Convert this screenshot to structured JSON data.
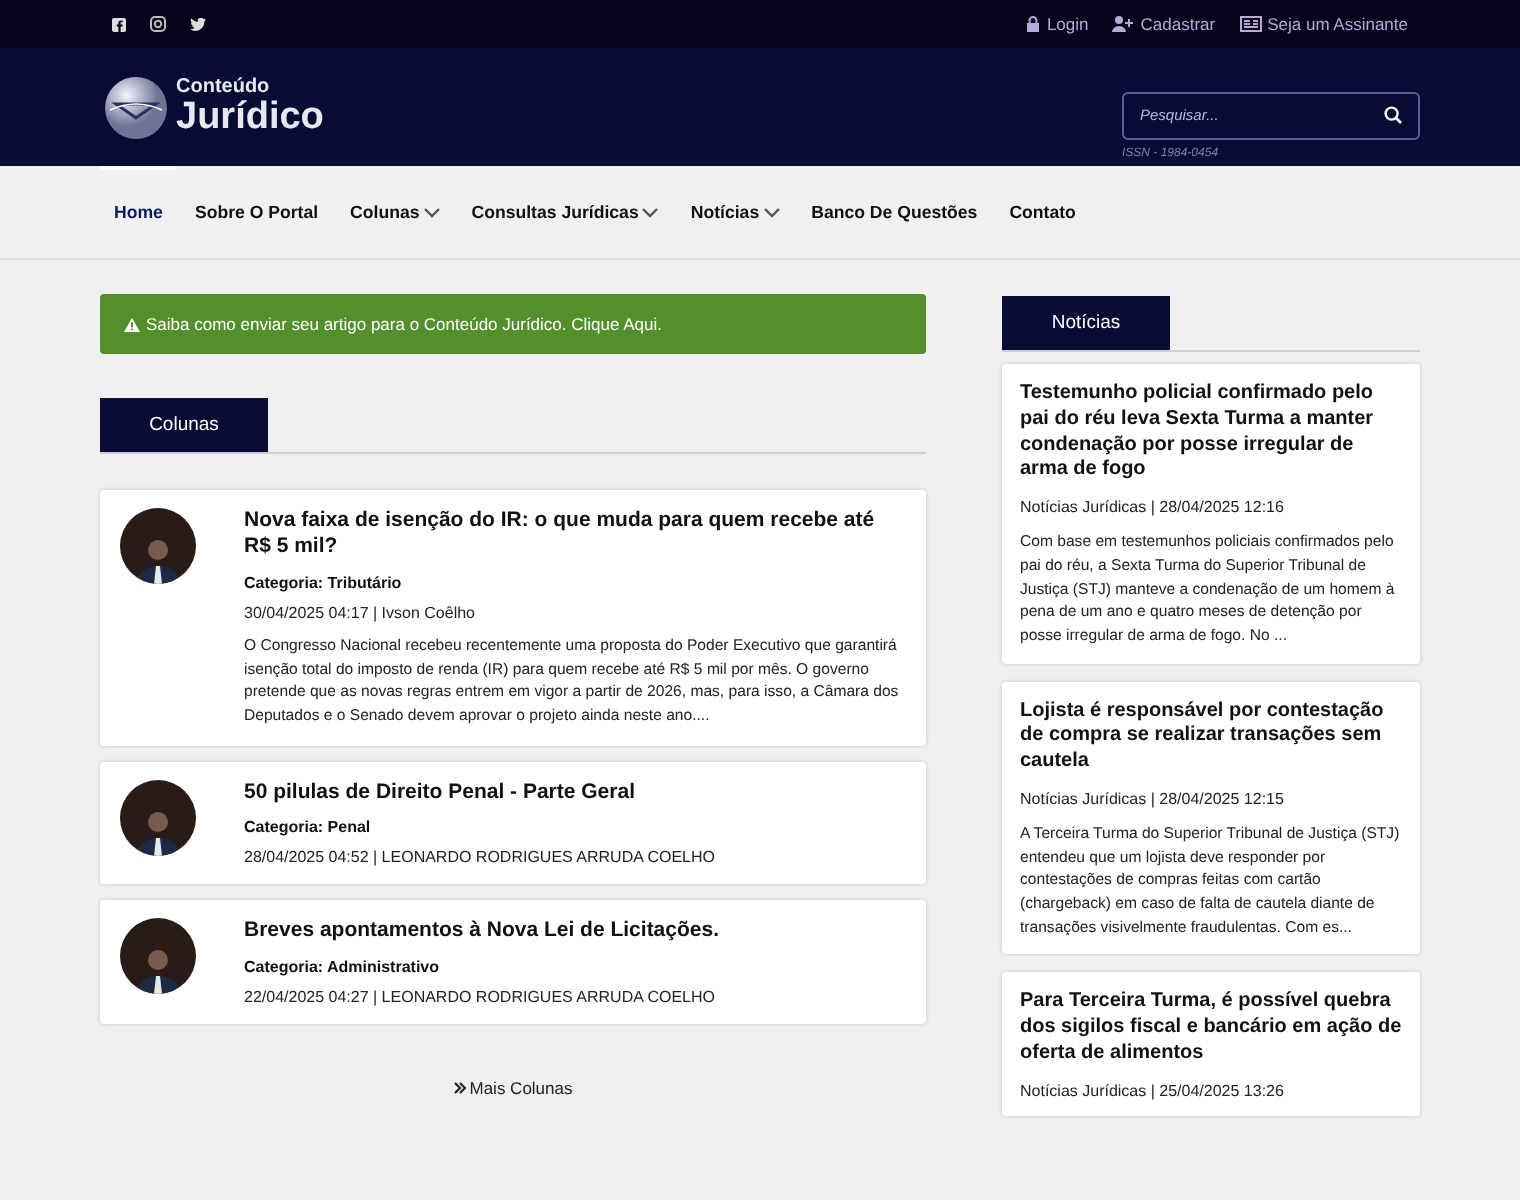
{
  "top_bar": {
    "links": [
      {
        "label": "Login"
      },
      {
        "label": "Cadastrar"
      },
      {
        "label": "Seja um Assinante"
      }
    ]
  },
  "header": {
    "logo": {
      "small": "Conteúdo",
      "big": "Jurídico"
    },
    "search": {
      "placeholder": "Pesquisar..."
    },
    "issn": "ISSN - 1984-0454"
  },
  "nav": [
    {
      "label": "Home",
      "selected": true,
      "dropdown": false
    },
    {
      "label": "Sobre O Portal",
      "selected": false,
      "dropdown": false
    },
    {
      "label": "Colunas",
      "selected": false,
      "dropdown": true
    },
    {
      "label": "Consultas Jurídicas",
      "selected": false,
      "dropdown": true
    },
    {
      "label": "Notícias",
      "selected": false,
      "dropdown": true
    },
    {
      "label": "Banco De Questões",
      "selected": false,
      "dropdown": false
    },
    {
      "label": "Contato",
      "selected": false,
      "dropdown": false
    }
  ],
  "alert": "Saiba como enviar seu artigo para o Conteúdo Jurídico. Clique Aqui.",
  "columns_section": {
    "tab": "Colunas",
    "articles": [
      {
        "title": "Nova faixa de isenção do IR: o que muda para quem recebe até R$ 5 mil?",
        "category": "Categoria: Tributário",
        "meta": "30/04/2025 04:17 | Ivson Coêlho",
        "excerpt": "O Congresso Nacional recebeu recentemente uma proposta do Poder Executivo que garantirá isenção total do imposto de renda (IR) para quem recebe até R$ 5 mil por mês. O governo pretende que as novas regras entrem em vigor a partir de 2026, mas, para isso, a Câmara dos Deputados e o Senado devem aprovar o projeto ainda neste ano...."
      },
      {
        "title": "50 pilulas de Direito Penal - Parte Geral",
        "category": "Categoria: Penal",
        "meta": "28/04/2025 04:52 | LEONARDO RODRIGUES ARRUDA COELHO"
      },
      {
        "title": "Breves apontamentos à Nova Lei de Licitações.",
        "category": "Categoria: Administrativo",
        "meta": "22/04/2025 04:27 | LEONARDO RODRIGUES ARRUDA COELHO"
      }
    ],
    "more": "Mais Colunas"
  },
  "news_section": {
    "tab": "Notícias",
    "items": [
      {
        "title": "Testemunho policial confirmado pelo pai do réu leva Sexta Turma a manter condenação por posse irregular de arma de fogo",
        "meta": "Notícias Jurídicas | 28/04/2025 12:16",
        "excerpt": "Com base em testemunhos policiais confirmados pelo pai do réu, a Sexta Turma do Superior Tribunal de Justiça (STJ) manteve a condenação de um homem à pena de um ano e quatro meses de detenção por posse irregular de arma de fogo. No ..."
      },
      {
        "title": "Lojista é responsável por contestação de compra se realizar transações sem cautela",
        "meta": "Notícias Jurídicas | 28/04/2025 12:15",
        "excerpt": "A Terceira Turma do Superior Tribunal de Justiça (STJ) entendeu que um lojista deve responder por contestações de compras feitas com cartão (chargeback) em caso de falta de cautela diante de transações visivelmente fraudulentas. Com es..."
      },
      {
        "title": "Para Terceira Turma, é possível quebra dos sigilos fiscal e bancário em ação de oferta de alimentos",
        "meta": "Notícias Jurídicas | 25/04/2025 13:26"
      }
    ]
  }
}
